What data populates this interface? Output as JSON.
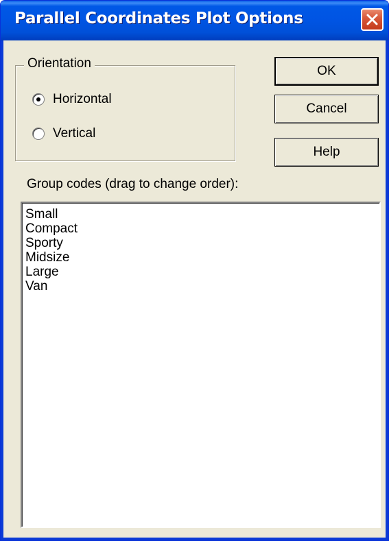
{
  "window": {
    "title": "Parallel Coordinates Plot Options"
  },
  "orientation": {
    "legend": "Orientation",
    "options": [
      {
        "label": "Horizontal",
        "checked": true
      },
      {
        "label": "Vertical",
        "checked": false
      }
    ]
  },
  "buttons": {
    "ok": "OK",
    "cancel": "Cancel",
    "help": "Help"
  },
  "group_codes": {
    "label": "Group codes (drag to change order):",
    "items": [
      "Small",
      "Compact",
      "Sporty",
      "Midsize",
      "Large",
      "Van"
    ]
  },
  "colors": {
    "title_bar": "#0054e3",
    "close_button": "#d85a3c",
    "dialog_face": "#ece9d8"
  },
  "icons": {
    "close": "close-icon"
  }
}
